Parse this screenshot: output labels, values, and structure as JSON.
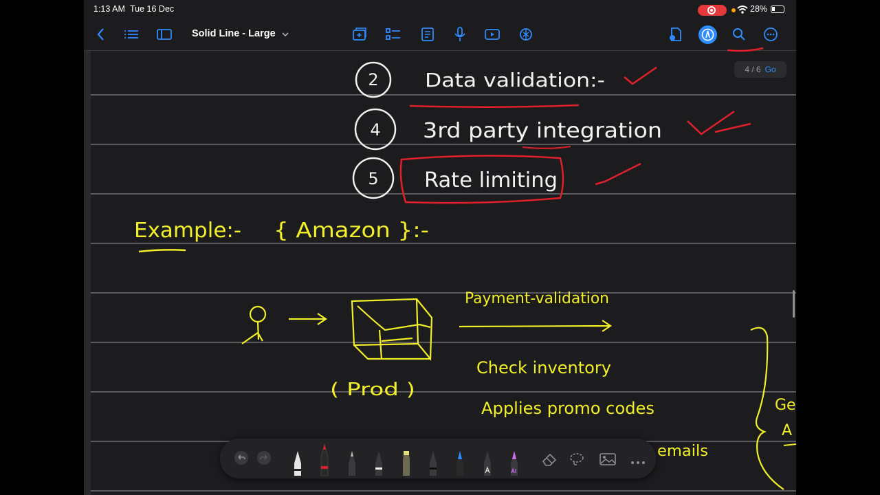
{
  "status": {
    "time": "1:13 AM",
    "date": "Tue 16 Dec",
    "battery": "28%"
  },
  "toolbar": {
    "title": "Solid Line - Large"
  },
  "page_indicator": {
    "label": "4 / 6",
    "go": "Go"
  },
  "notes": {
    "item2_number": "2",
    "item2_text": "Data validation:-",
    "item4_number": "4",
    "item4_text": "3rd party integration",
    "item5_number": "5",
    "item5_text": "Rate limiting",
    "example_label": "Example:-",
    "example_value": "{ Amazon }:-",
    "payment": "Payment-validation",
    "inventory": "Check inventory",
    "promo": "Applies promo codes",
    "emails": "emails",
    "prod": "( Prod )",
    "right_partial_1": "Ge",
    "right_partial_2": "A"
  },
  "colors": {
    "ink_white": "#f2f2f2",
    "ink_yellow": "#f1ee2a",
    "ink_red": "#e0202a",
    "accent": "#2f8cff"
  }
}
